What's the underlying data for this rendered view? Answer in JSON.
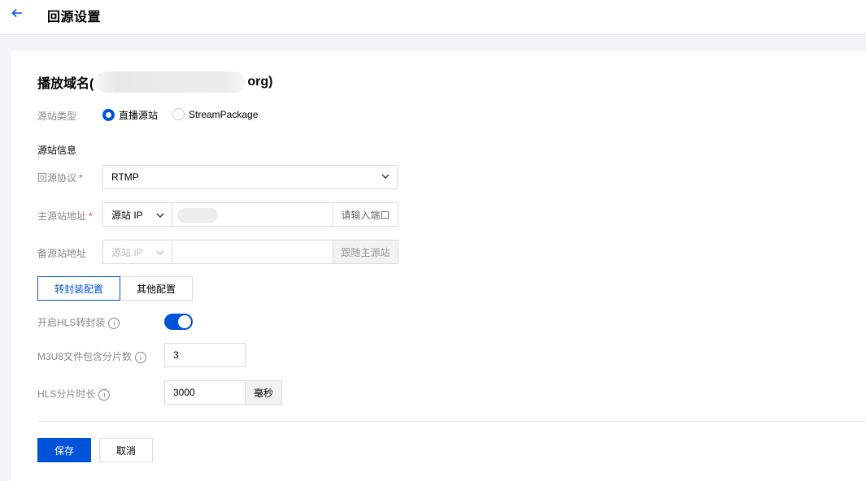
{
  "header": {
    "back_icon": "arrow-left-icon",
    "title": "回源设置"
  },
  "domain": {
    "prefix": "播放域名(",
    "suffix": "org)"
  },
  "source_type": {
    "label": "源站类型",
    "options": [
      "直播源站",
      "StreamPackage"
    ],
    "selected": "直播源站"
  },
  "source_info": {
    "title": "源站信息",
    "protocol_label": "回源协议",
    "protocol_value": "RTMP",
    "primary_label": "主源站地址",
    "primary_type": "源站 IP",
    "primary_port_placeholder": "请输入端口",
    "backup_label": "备源站地址",
    "backup_type": "源站 IP",
    "backup_port_placeholder": "跟随主源站",
    "required_mark": "*"
  },
  "tabs": [
    "转封装配置",
    "其他配置"
  ],
  "hls": {
    "enable_label": "开启HLS转封装",
    "enabled": true,
    "m3u8_label": "M3U8文件包含分片数",
    "m3u8_value": "3",
    "duration_label": "HLS分片时长",
    "duration_value": "3000",
    "duration_unit": "毫秒"
  },
  "actions": {
    "save": "保存",
    "cancel": "取消"
  },
  "colors": {
    "accent": "#0052d9",
    "required": "#e54545"
  }
}
